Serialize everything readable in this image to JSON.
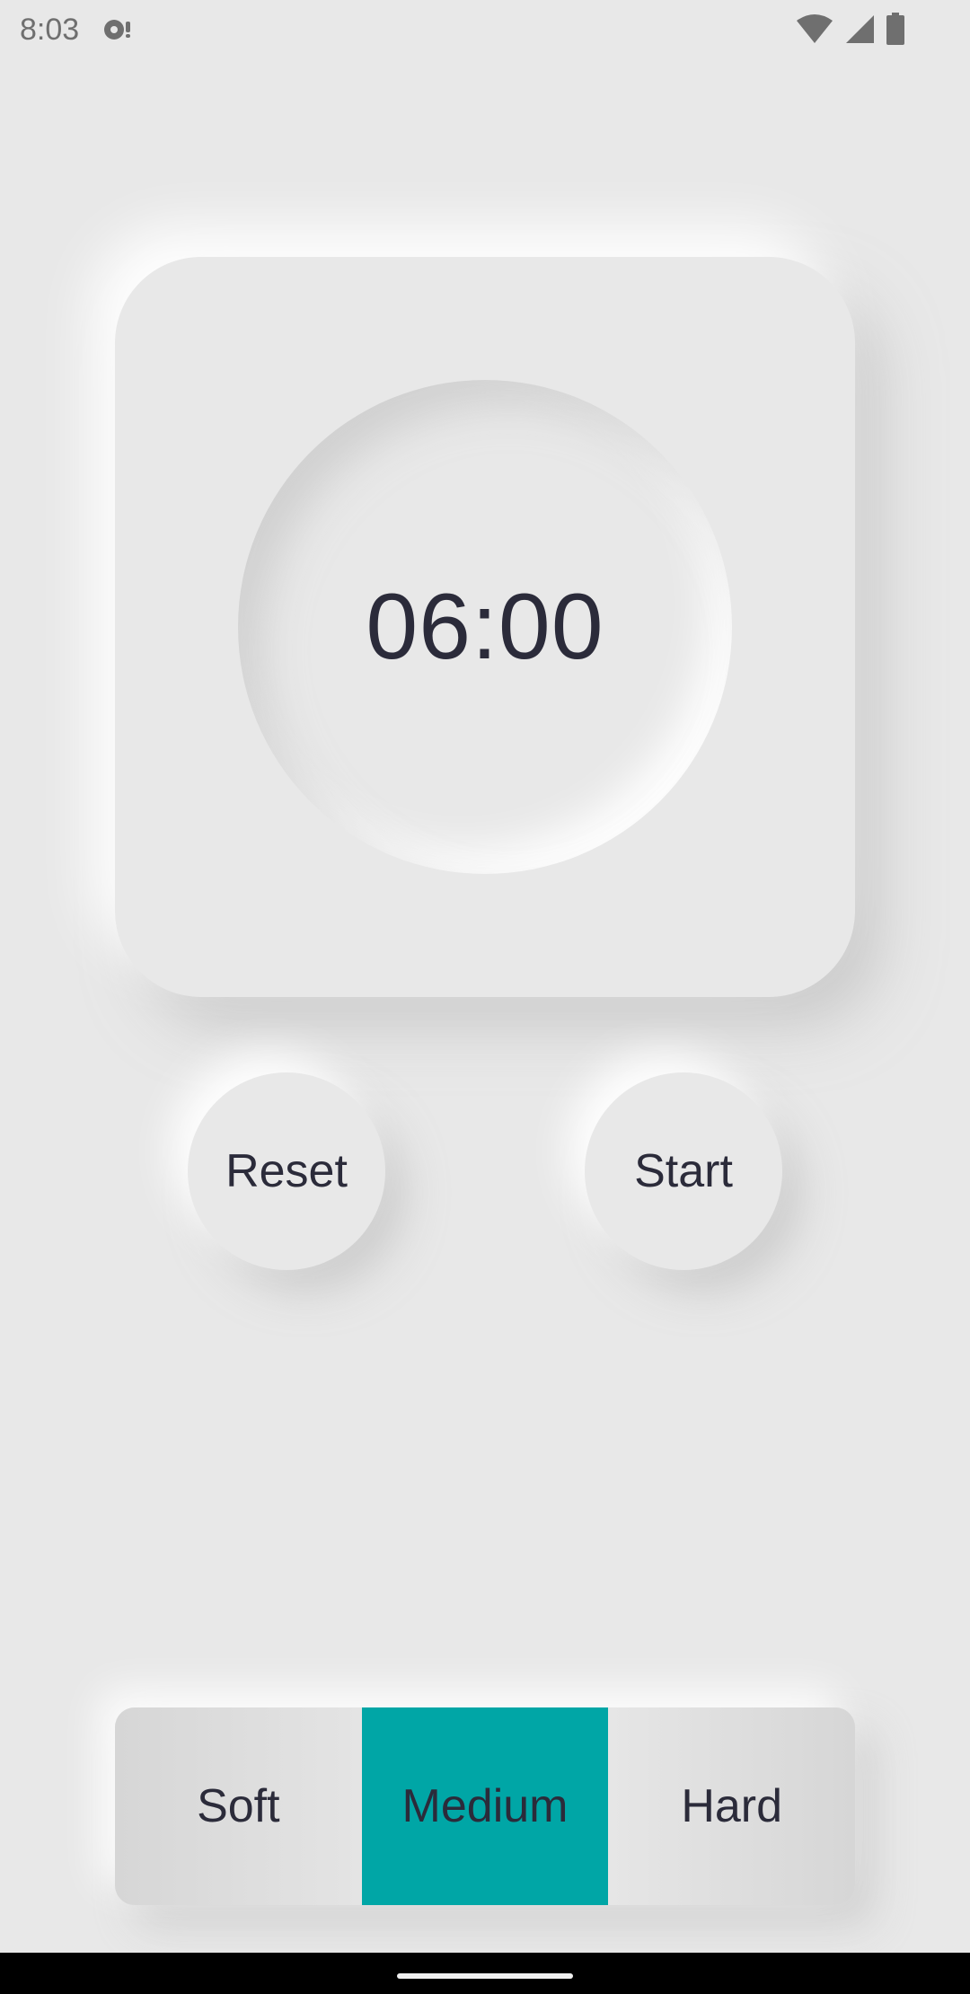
{
  "status_bar": {
    "time": "8:03",
    "icons": [
      "app-notification-icon",
      "wifi-icon",
      "cellular-signal-icon",
      "battery-icon"
    ]
  },
  "timer": {
    "display": "06:00"
  },
  "controls": {
    "reset_label": "Reset",
    "start_label": "Start"
  },
  "egg_types": {
    "options": [
      {
        "label": "Soft",
        "selected": false
      },
      {
        "label": "Medium",
        "selected": true
      },
      {
        "label": "Hard",
        "selected": false
      }
    ]
  },
  "colors": {
    "background": "#e8e8e8",
    "accent": "#00a6a6",
    "text": "#2b2b3a",
    "status_text": "#6f6f6f"
  }
}
